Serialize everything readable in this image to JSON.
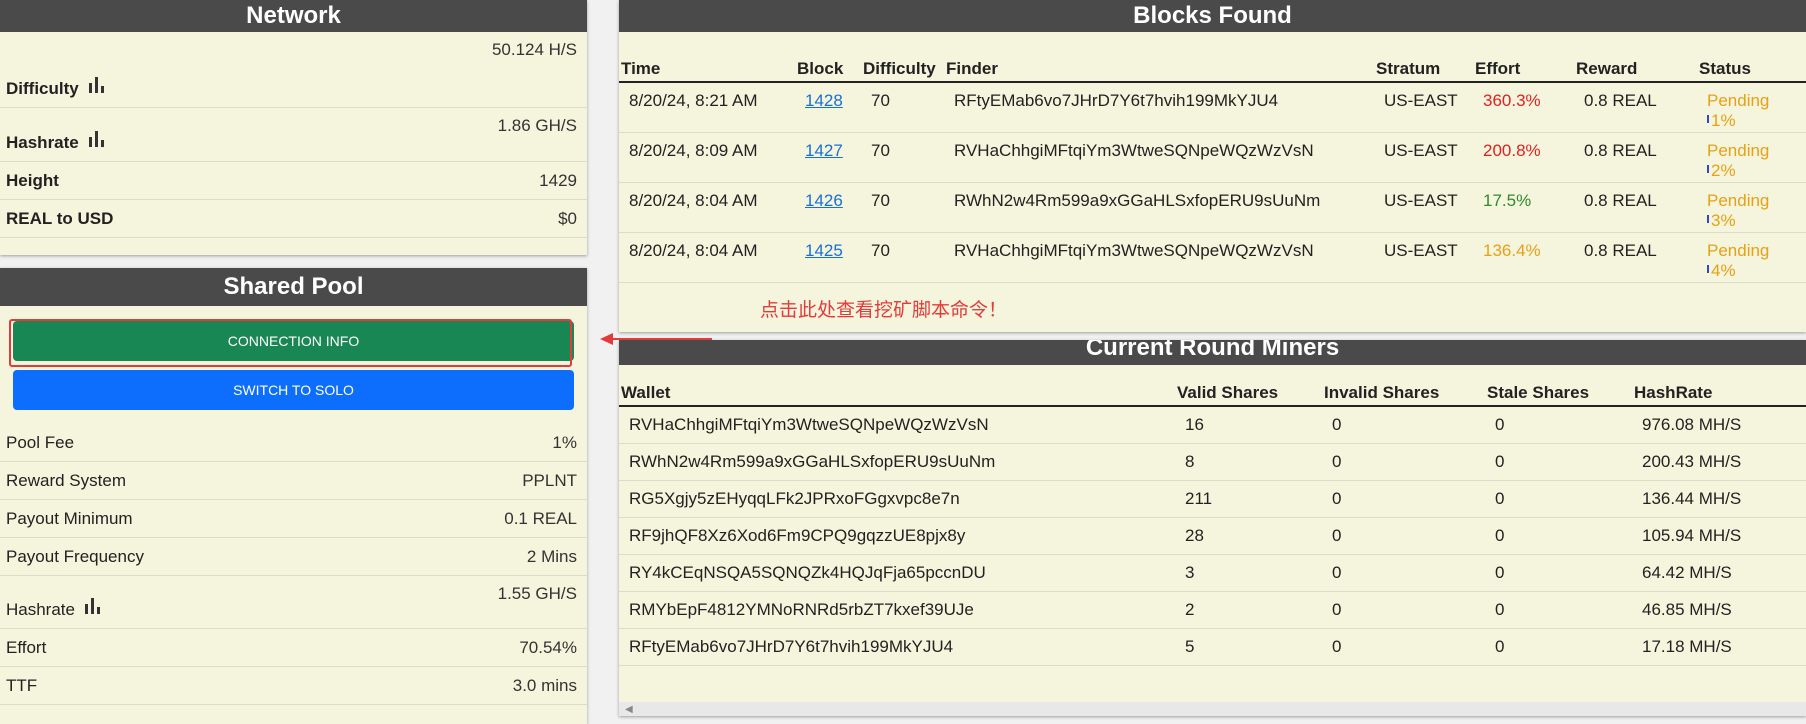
{
  "network": {
    "title": "Network",
    "difficulty_label": "Difficulty",
    "difficulty_value": "50.124 H/S",
    "hashrate_label": "Hashrate",
    "hashrate_value": "1.86 GH/S",
    "height_label": "Height",
    "height_value": "1429",
    "usd_label": "REAL to USD",
    "usd_value": "$0"
  },
  "pool": {
    "title": "Shared Pool",
    "connection_button": "CONNECTION INFO",
    "solo_button": "SWITCH TO SOLO",
    "rows": [
      {
        "label": "Pool Fee",
        "value": "1%"
      },
      {
        "label": "Reward System",
        "value": "PPLNT"
      },
      {
        "label": "Payout Minimum",
        "value": "0.1 REAL"
      },
      {
        "label": "Payout Frequency",
        "value": "2 Mins"
      }
    ],
    "hashrate_label": "Hashrate",
    "hashrate_value": "1.55 GH/S",
    "effort_label": "Effort",
    "effort_value": "70.54%",
    "ttf_label": "TTF",
    "ttf_value": "3.0 mins"
  },
  "annotation": "点击此处查看挖矿脚本命令！",
  "blocks": {
    "title": "Blocks Found",
    "columns": [
      "Time",
      "Block",
      "Difficulty",
      "Finder",
      "Stratum",
      "Effort",
      "Reward",
      "Status"
    ],
    "rows": [
      {
        "time": "8/20/24, 8:21 AM",
        "block": "1428",
        "difficulty": "70",
        "finder": "RFtyEMab6vo7JHrD7Y6t7hvih199MkYJU4",
        "stratum": "US-EAST",
        "effort": "360.3%",
        "effort_color": "#dd2222",
        "reward": "0.8 REAL",
        "status": "Pending",
        "progress": "1%"
      },
      {
        "time": "8/20/24, 8:09 AM",
        "block": "1427",
        "difficulty": "70",
        "finder": "RVHaChhgiMFtqiYm3WtweSQNpeWQzWzVsN",
        "stratum": "US-EAST",
        "effort": "200.8%",
        "effort_color": "#dd2222",
        "reward": "0.8 REAL",
        "status": "Pending",
        "progress": "2%"
      },
      {
        "time": "8/20/24, 8:04 AM",
        "block": "1426",
        "difficulty": "70",
        "finder": "RWhN2w4Rm599a9xGGaHLSxfopERU9sUuNm",
        "stratum": "US-EAST",
        "effort": "17.5%",
        "effort_color": "#2e8b2e",
        "reward": "0.8 REAL",
        "status": "Pending",
        "progress": "3%"
      },
      {
        "time": "8/20/24, 8:04 AM",
        "block": "1425",
        "difficulty": "70",
        "finder": "RVHaChhgiMFtqiYm3WtweSQNpeWQzWzVsN",
        "stratum": "US-EAST",
        "effort": "136.4%",
        "effort_color": "#e8a016",
        "reward": "0.8 REAL",
        "status": "Pending",
        "progress": "4%"
      }
    ]
  },
  "miners": {
    "title": "Current Round Miners",
    "columns": [
      "Wallet",
      "Valid Shares",
      "Invalid Shares",
      "Stale Shares",
      "HashRate"
    ],
    "rows": [
      {
        "wallet": "RVHaChhgiMFtqiYm3WtweSQNpeWQzWzVsN",
        "valid": "16",
        "invalid": "0",
        "stale": "0",
        "hashrate": "976.08 MH/S"
      },
      {
        "wallet": "RWhN2w4Rm599a9xGGaHLSxfopERU9sUuNm",
        "valid": "8",
        "invalid": "0",
        "stale": "0",
        "hashrate": "200.43 MH/S"
      },
      {
        "wallet": "RG5Xgjy5zEHyqqLFk2JPRxoFGgxvpc8e7n",
        "valid": "211",
        "invalid": "0",
        "stale": "0",
        "hashrate": "136.44 MH/S"
      },
      {
        "wallet": "RF9jhQF8Xz6Xod6Fm9CPQ9gqzzUE8pjx8y",
        "valid": "28",
        "invalid": "0",
        "stale": "0",
        "hashrate": "105.94 MH/S"
      },
      {
        "wallet": "RY4kCEqNSQA5SQNQZk4HQJqFja65pccnDU",
        "valid": "3",
        "invalid": "0",
        "stale": "0",
        "hashrate": "64.42 MH/S"
      },
      {
        "wallet": "RMYbEpF4812YMNoRNRd5rbZT7kxef39UJe",
        "valid": "2",
        "invalid": "0",
        "stale": "0",
        "hashrate": "46.85 MH/S"
      },
      {
        "wallet": "RFtyEMab6vo7JHrD7Y6t7hvih199MkYJU4",
        "valid": "5",
        "invalid": "0",
        "stale": "0",
        "hashrate": "17.18 MH/S"
      }
    ]
  }
}
